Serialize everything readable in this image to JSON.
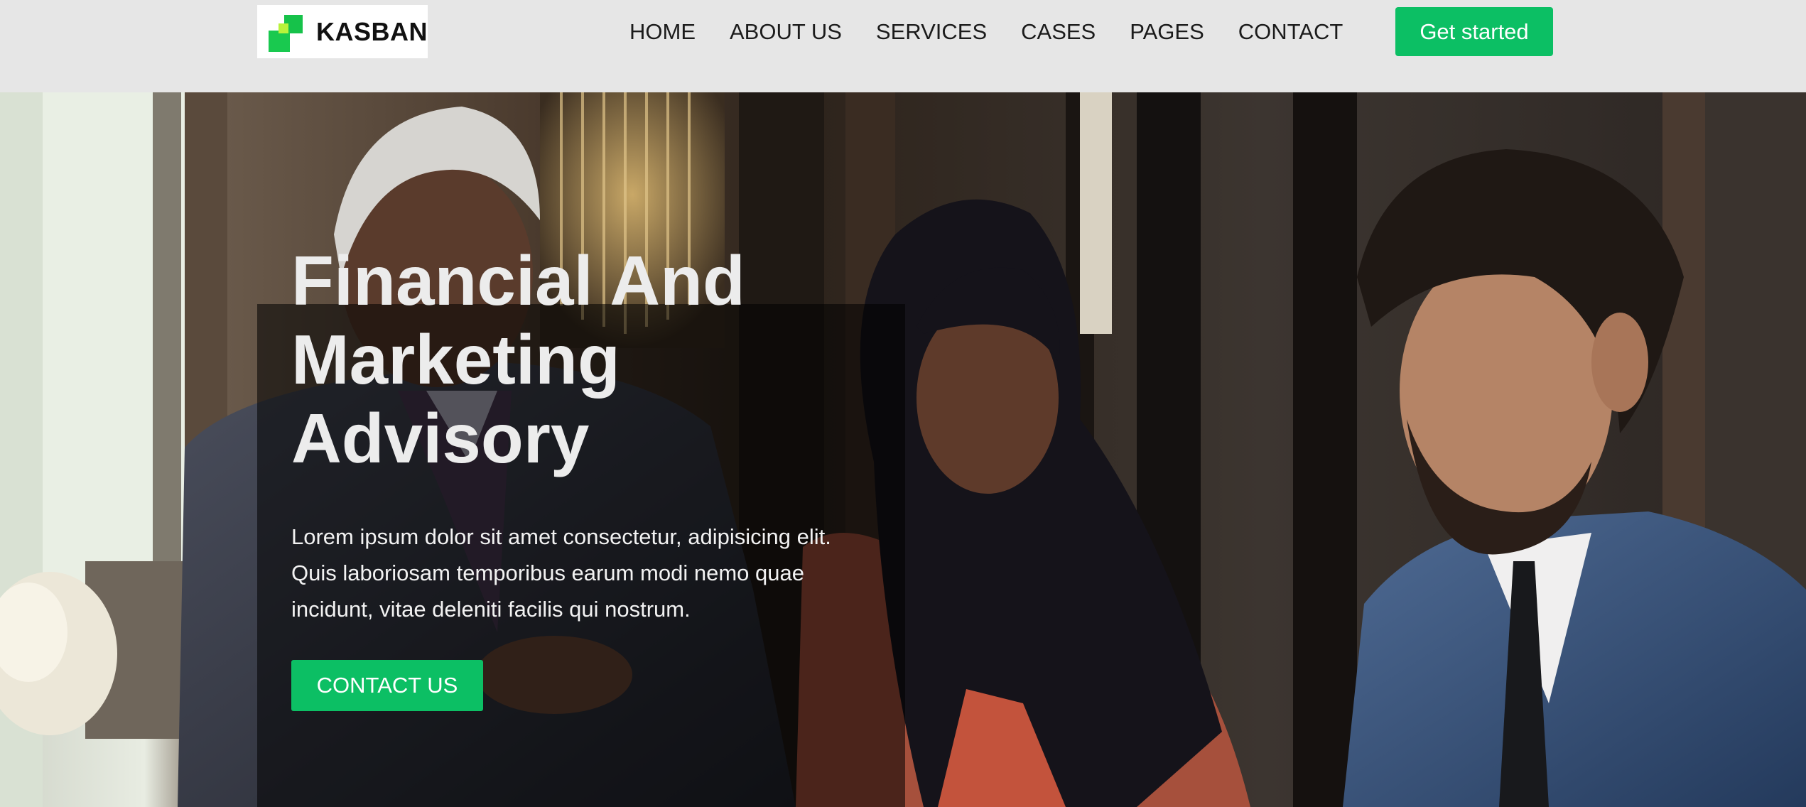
{
  "brand": {
    "name": "KASBAN"
  },
  "nav": {
    "items": [
      {
        "label": "HOME"
      },
      {
        "label": "ABOUT US"
      },
      {
        "label": "SERVICES"
      },
      {
        "label": "CASES"
      },
      {
        "label": "PAGES"
      },
      {
        "label": "CONTACT"
      }
    ],
    "cta_label": "Get started"
  },
  "hero": {
    "title_lines": [
      "Financial And",
      "Marketing",
      "Advisory"
    ],
    "text_lines": [
      "Lorem ipsum dolor sit amet consectetur, adipisicing elit.",
      "Quis laboriosam temporibus earum modi nemo quae",
      "incidunt, vitae deleniti facilis qui nostrum."
    ],
    "button_label": "CONTACT US",
    "image_subject": "three business people in a meeting"
  },
  "colors": {
    "accent": "#0cbf64",
    "nav_background": "#e6e6e6",
    "logo_green": "#16c24a",
    "logo_lime": "#b8f33b"
  }
}
